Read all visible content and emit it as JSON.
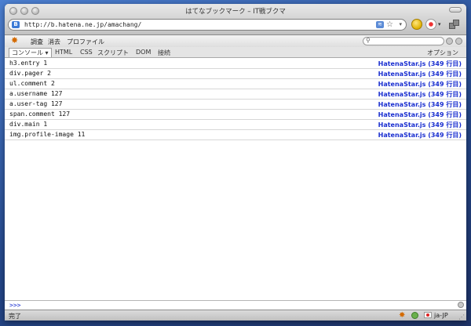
{
  "window": {
    "title": "はてなブックマーク – IT戦ブクマ"
  },
  "address": {
    "url": "http://b.hatena.ne.jp/amachang/",
    "site_icon": "B"
  },
  "firebug": {
    "menu": [
      "調査",
      "消去",
      "プロファイル"
    ],
    "tabs": [
      "コンソール ▾",
      "HTML",
      "CSS",
      "スクリプト",
      "DOM",
      "接続"
    ],
    "options": "オプション",
    "rows": [
      {
        "code": "h3.entry 1",
        "source": "HatenaStar.js (349 行目)"
      },
      {
        "code": "div.pager 2",
        "source": "HatenaStar.js (349 行目)"
      },
      {
        "code": "ul.comment 2",
        "source": "HatenaStar.js (349 行目)"
      },
      {
        "code": "a.username 127",
        "source": "HatenaStar.js (349 行目)"
      },
      {
        "code": "a.user-tag 127",
        "source": "HatenaStar.js (349 行目)"
      },
      {
        "code": "span.comment 127",
        "source": "HatenaStar.js (349 行目)"
      },
      {
        "code": "div.main 1",
        "source": "HatenaStar.js (349 行目)"
      },
      {
        "code": "img.profile-image 11",
        "source": "HatenaStar.js (349 行目)"
      }
    ],
    "prompt": ">>>"
  },
  "status": {
    "text": "完了",
    "lang": "ja-JP"
  }
}
